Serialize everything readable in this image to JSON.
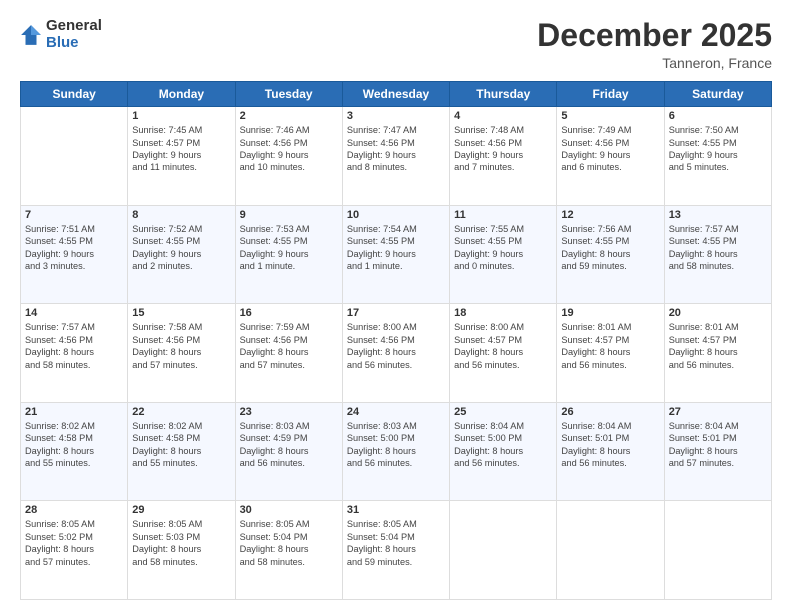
{
  "header": {
    "logo_general": "General",
    "logo_blue": "Blue",
    "month_title": "December 2025",
    "location": "Tanneron, France"
  },
  "days_of_week": [
    "Sunday",
    "Monday",
    "Tuesday",
    "Wednesday",
    "Thursday",
    "Friday",
    "Saturday"
  ],
  "weeks": [
    [
      {
        "day": "",
        "text": ""
      },
      {
        "day": "1",
        "text": "Sunrise: 7:45 AM\nSunset: 4:57 PM\nDaylight: 9 hours\nand 11 minutes."
      },
      {
        "day": "2",
        "text": "Sunrise: 7:46 AM\nSunset: 4:56 PM\nDaylight: 9 hours\nand 10 minutes."
      },
      {
        "day": "3",
        "text": "Sunrise: 7:47 AM\nSunset: 4:56 PM\nDaylight: 9 hours\nand 8 minutes."
      },
      {
        "day": "4",
        "text": "Sunrise: 7:48 AM\nSunset: 4:56 PM\nDaylight: 9 hours\nand 7 minutes."
      },
      {
        "day": "5",
        "text": "Sunrise: 7:49 AM\nSunset: 4:56 PM\nDaylight: 9 hours\nand 6 minutes."
      },
      {
        "day": "6",
        "text": "Sunrise: 7:50 AM\nSunset: 4:55 PM\nDaylight: 9 hours\nand 5 minutes."
      }
    ],
    [
      {
        "day": "7",
        "text": "Sunrise: 7:51 AM\nSunset: 4:55 PM\nDaylight: 9 hours\nand 3 minutes."
      },
      {
        "day": "8",
        "text": "Sunrise: 7:52 AM\nSunset: 4:55 PM\nDaylight: 9 hours\nand 2 minutes."
      },
      {
        "day": "9",
        "text": "Sunrise: 7:53 AM\nSunset: 4:55 PM\nDaylight: 9 hours\nand 1 minute."
      },
      {
        "day": "10",
        "text": "Sunrise: 7:54 AM\nSunset: 4:55 PM\nDaylight: 9 hours\nand 1 minute."
      },
      {
        "day": "11",
        "text": "Sunrise: 7:55 AM\nSunset: 4:55 PM\nDaylight: 9 hours\nand 0 minutes."
      },
      {
        "day": "12",
        "text": "Sunrise: 7:56 AM\nSunset: 4:55 PM\nDaylight: 8 hours\nand 59 minutes."
      },
      {
        "day": "13",
        "text": "Sunrise: 7:57 AM\nSunset: 4:55 PM\nDaylight: 8 hours\nand 58 minutes."
      }
    ],
    [
      {
        "day": "14",
        "text": "Sunrise: 7:57 AM\nSunset: 4:56 PM\nDaylight: 8 hours\nand 58 minutes."
      },
      {
        "day": "15",
        "text": "Sunrise: 7:58 AM\nSunset: 4:56 PM\nDaylight: 8 hours\nand 57 minutes."
      },
      {
        "day": "16",
        "text": "Sunrise: 7:59 AM\nSunset: 4:56 PM\nDaylight: 8 hours\nand 57 minutes."
      },
      {
        "day": "17",
        "text": "Sunrise: 8:00 AM\nSunset: 4:56 PM\nDaylight: 8 hours\nand 56 minutes."
      },
      {
        "day": "18",
        "text": "Sunrise: 8:00 AM\nSunset: 4:57 PM\nDaylight: 8 hours\nand 56 minutes."
      },
      {
        "day": "19",
        "text": "Sunrise: 8:01 AM\nSunset: 4:57 PM\nDaylight: 8 hours\nand 56 minutes."
      },
      {
        "day": "20",
        "text": "Sunrise: 8:01 AM\nSunset: 4:57 PM\nDaylight: 8 hours\nand 56 minutes."
      }
    ],
    [
      {
        "day": "21",
        "text": "Sunrise: 8:02 AM\nSunset: 4:58 PM\nDaylight: 8 hours\nand 55 minutes."
      },
      {
        "day": "22",
        "text": "Sunrise: 8:02 AM\nSunset: 4:58 PM\nDaylight: 8 hours\nand 55 minutes."
      },
      {
        "day": "23",
        "text": "Sunrise: 8:03 AM\nSunset: 4:59 PM\nDaylight: 8 hours\nand 56 minutes."
      },
      {
        "day": "24",
        "text": "Sunrise: 8:03 AM\nSunset: 5:00 PM\nDaylight: 8 hours\nand 56 minutes."
      },
      {
        "day": "25",
        "text": "Sunrise: 8:04 AM\nSunset: 5:00 PM\nDaylight: 8 hours\nand 56 minutes."
      },
      {
        "day": "26",
        "text": "Sunrise: 8:04 AM\nSunset: 5:01 PM\nDaylight: 8 hours\nand 56 minutes."
      },
      {
        "day": "27",
        "text": "Sunrise: 8:04 AM\nSunset: 5:01 PM\nDaylight: 8 hours\nand 57 minutes."
      }
    ],
    [
      {
        "day": "28",
        "text": "Sunrise: 8:05 AM\nSunset: 5:02 PM\nDaylight: 8 hours\nand 57 minutes."
      },
      {
        "day": "29",
        "text": "Sunrise: 8:05 AM\nSunset: 5:03 PM\nDaylight: 8 hours\nand 58 minutes."
      },
      {
        "day": "30",
        "text": "Sunrise: 8:05 AM\nSunset: 5:04 PM\nDaylight: 8 hours\nand 58 minutes."
      },
      {
        "day": "31",
        "text": "Sunrise: 8:05 AM\nSunset: 5:04 PM\nDaylight: 8 hours\nand 59 minutes."
      },
      {
        "day": "",
        "text": ""
      },
      {
        "day": "",
        "text": ""
      },
      {
        "day": "",
        "text": ""
      }
    ]
  ]
}
